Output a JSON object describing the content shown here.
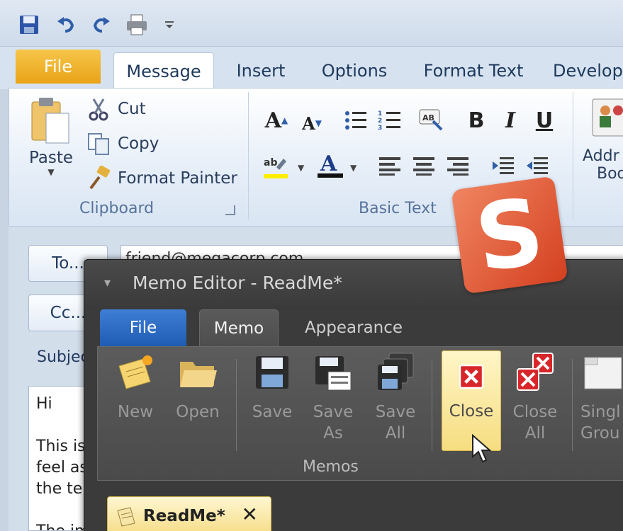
{
  "outlook": {
    "tabs": [
      "File",
      "Message",
      "Insert",
      "Options",
      "Format Text",
      "Develop"
    ],
    "clipboard": {
      "paste": "Paste",
      "cut": "Cut",
      "copy": "Copy",
      "format_painter": "Format Painter",
      "group_label": "Clipboard"
    },
    "basic_text": {
      "group_label": "Basic Text",
      "bold": "B",
      "italic": "I",
      "underline": "U"
    },
    "names": {
      "label_line1": "Addr",
      "label_line2": "Boo"
    },
    "compose": {
      "to_button": "To...",
      "cc_button": "Cc...",
      "to_value": "friend@megacorp.com",
      "subject_label": "Subjec",
      "body_lines": [
        "Hi",
        "",
        "This is",
        "feel as",
        "the te",
        "",
        "The im"
      ]
    }
  },
  "memo_editor": {
    "title": "Memo Editor - ReadMe*",
    "tabs": {
      "file": "File",
      "memo": "Memo",
      "appearance": "Appearance"
    },
    "buttons": {
      "new": "New",
      "open": "Open",
      "save": "Save",
      "save_as_1": "Save",
      "save_as_2": "As",
      "save_all_1": "Save",
      "save_all_2": "All",
      "close": "Close",
      "close_all_1": "Close",
      "close_all_2": "All",
      "single_group_1": "Singl",
      "single_group_2": "Grou"
    },
    "group_label": "Memos",
    "doc_tab": "ReadMe*",
    "doc_tab_close": "✕"
  },
  "colors": {
    "logo": "#e05a35",
    "file_tab_outlook": "#f0b42c",
    "file_tab_memo": "#2a6bc6"
  },
  "logo": {
    "letter": "S"
  }
}
